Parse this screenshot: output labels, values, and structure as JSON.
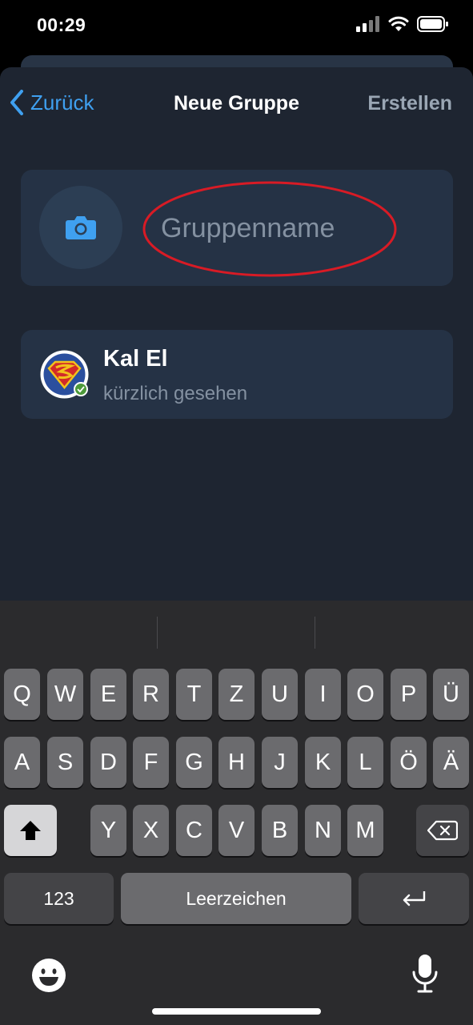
{
  "status_bar": {
    "time": "00:29"
  },
  "nav": {
    "back_label": "Zurück",
    "title": "Neue Gruppe",
    "create_label": "Erstellen"
  },
  "group": {
    "name_placeholder": "Gruppenname",
    "name_value": ""
  },
  "member": {
    "name": "Kal El",
    "status": "kürzlich gesehen"
  },
  "keyboard": {
    "row1": [
      "Q",
      "W",
      "E",
      "R",
      "T",
      "Z",
      "U",
      "I",
      "O",
      "P",
      "Ü"
    ],
    "row2": [
      "A",
      "S",
      "D",
      "F",
      "G",
      "H",
      "J",
      "K",
      "L",
      "Ö",
      "Ä"
    ],
    "row3": [
      "Y",
      "X",
      "C",
      "V",
      "B",
      "N",
      "M"
    ],
    "numbers_label": "123",
    "space_label": "Leerzeichen"
  },
  "colors": {
    "accent": "#3fa0f0",
    "annotation": "#d81b25",
    "sheet_bg": "#1e2531",
    "card_bg": "#253245"
  },
  "icons": [
    "chevron-left-icon",
    "camera-icon",
    "shift-icon",
    "backspace-icon",
    "return-icon",
    "emoji-icon",
    "microphone-icon",
    "signal-icon",
    "wifi-icon",
    "battery-icon"
  ]
}
